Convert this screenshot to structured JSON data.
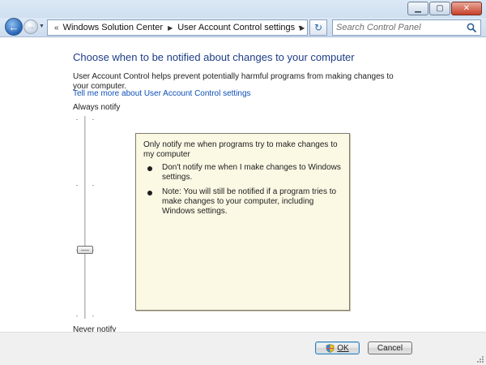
{
  "window": {
    "controls": [
      "minimize",
      "maximize",
      "close"
    ]
  },
  "nav": {
    "breadcrumb": [
      "Windows Solution Center",
      "User Account Control settings"
    ],
    "overflow_chevrons": "«",
    "search_placeholder": "Search Control Panel"
  },
  "main": {
    "title": "Choose when to be notified about changes to your computer",
    "description": "User Account Control helps prevent potentially harmful programs from making changes to your computer.",
    "learn_more": "Tell me more about User Account Control settings",
    "slider": {
      "top_label": "Always notify",
      "bottom_label": "Never notify",
      "levels": 4,
      "selected_level": 3
    },
    "info": {
      "heading": "Only notify me when programs try to make changes to my computer",
      "bullets": [
        "Don't notify me when I make changes to Windows settings.",
        "Note: You will still be notified if a program tries to make changes to your computer, including Windows settings."
      ]
    }
  },
  "footer": {
    "ok_label": "OK",
    "cancel_label": "Cancel"
  },
  "colors": {
    "title_blue": "#1e3d87",
    "link_blue": "#0c4fb6",
    "info_bg": "#fbf8e4"
  },
  "icons": [
    "back-arrow-icon",
    "forward-arrow-icon",
    "control-panel-icon",
    "refresh-icon",
    "search-icon",
    "shield-icon"
  ]
}
